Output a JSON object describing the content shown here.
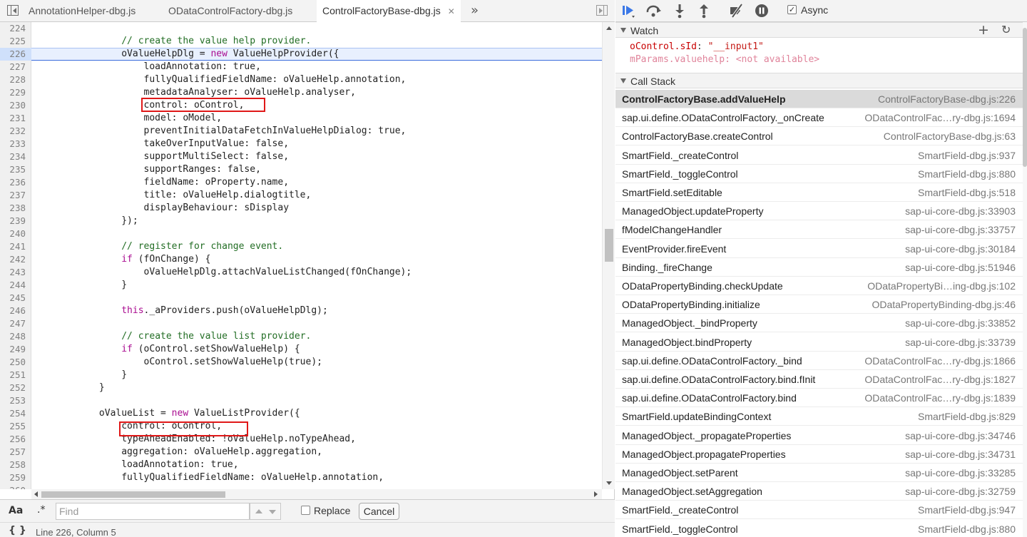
{
  "tabs": [
    {
      "label": "AnnotationHelper-dbg.js",
      "active": false
    },
    {
      "label": "ODataControlFactory-dbg.js",
      "active": false
    },
    {
      "label": "ControlFactoryBase-dbg.js",
      "active": true
    }
  ],
  "editor": {
    "current_line": 226,
    "lines": [
      {
        "n": "224",
        "text": ""
      },
      {
        "n": "225",
        "text": "                // create the value help provider."
      },
      {
        "n": "226",
        "text": "                oValueHelpDlg = new ValueHelpProvider({"
      },
      {
        "n": "227",
        "text": "                    loadAnnotation: true,"
      },
      {
        "n": "228",
        "text": "                    fullyQualifiedFieldName: oValueHelp.annotation,"
      },
      {
        "n": "229",
        "text": "                    metadataAnalyser: oValueHelp.analyser,"
      },
      {
        "n": "230",
        "text": "                    control: oControl,"
      },
      {
        "n": "231",
        "text": "                    model: oModel,"
      },
      {
        "n": "232",
        "text": "                    preventInitialDataFetchInValueHelpDialog: true,"
      },
      {
        "n": "233",
        "text": "                    takeOverInputValue: false,"
      },
      {
        "n": "234",
        "text": "                    supportMultiSelect: false,"
      },
      {
        "n": "235",
        "text": "                    supportRanges: false,"
      },
      {
        "n": "236",
        "text": "                    fieldName: oProperty.name,"
      },
      {
        "n": "237",
        "text": "                    title: oValueHelp.dialogtitle,"
      },
      {
        "n": "238",
        "text": "                    displayBehaviour: sDisplay"
      },
      {
        "n": "239",
        "text": "                });"
      },
      {
        "n": "240",
        "text": ""
      },
      {
        "n": "241",
        "text": "                // register for change event."
      },
      {
        "n": "242",
        "text": "                if (fOnChange) {"
      },
      {
        "n": "243",
        "text": "                    oValueHelpDlg.attachValueListChanged(fOnChange);"
      },
      {
        "n": "244",
        "text": "                }"
      },
      {
        "n": "245",
        "text": ""
      },
      {
        "n": "246",
        "text": "                this._aProviders.push(oValueHelpDlg);"
      },
      {
        "n": "247",
        "text": ""
      },
      {
        "n": "248",
        "text": "                // create the value list provider."
      },
      {
        "n": "249",
        "text": "                if (oControl.setShowValueHelp) {"
      },
      {
        "n": "250",
        "text": "                    oControl.setShowValueHelp(true);"
      },
      {
        "n": "251",
        "text": "                }"
      },
      {
        "n": "252",
        "text": "            }"
      },
      {
        "n": "253",
        "text": ""
      },
      {
        "n": "254",
        "text": "            oValueList = new ValueListProvider({"
      },
      {
        "n": "255",
        "text": "                control: oControl,"
      },
      {
        "n": "256",
        "text": "                typeAheadEnabled: !oValueHelp.noTypeAhead,"
      },
      {
        "n": "257",
        "text": "                aggregation: oValueHelp.aggregation,"
      },
      {
        "n": "258",
        "text": "                loadAnnotation: true,"
      },
      {
        "n": "259",
        "text": "                fullyQualifiedFieldName: oValueHelp.annotation,"
      },
      {
        "n": "260",
        "text": ""
      }
    ]
  },
  "find": {
    "case_label": "Aa",
    "regex_label": ".*",
    "placeholder": "Find",
    "replace_label": "Replace",
    "cancel_label": "Cancel"
  },
  "status": {
    "pretty_print_label": "{ }",
    "position_text": "Line 226, Column 5"
  },
  "debugger": {
    "async_label": "Async",
    "async_checked": true
  },
  "watch": {
    "title": "Watch",
    "items": [
      {
        "name": "oControl.sId",
        "value": "\"__input1\""
      },
      {
        "name": "mParams.valuehelp",
        "value": "<not available>"
      }
    ]
  },
  "callstack": {
    "title": "Call Stack",
    "frames": [
      {
        "fn": "ControlFactoryBase.addValueHelp",
        "loc": "ControlFactoryBase-dbg.js:226",
        "selected": true
      },
      {
        "fn": "sap.ui.define.ODataControlFactory._onCreate",
        "loc": "ODataControlFac…ry-dbg.js:1694"
      },
      {
        "fn": "ControlFactoryBase.createControl",
        "loc": "ControlFactoryBase-dbg.js:63"
      },
      {
        "fn": "SmartField._createControl",
        "loc": "SmartField-dbg.js:937"
      },
      {
        "fn": "SmartField._toggleControl",
        "loc": "SmartField-dbg.js:880"
      },
      {
        "fn": "SmartField.setEditable",
        "loc": "SmartField-dbg.js:518"
      },
      {
        "fn": "ManagedObject.updateProperty",
        "loc": "sap-ui-core-dbg.js:33903"
      },
      {
        "fn": "fModelChangeHandler",
        "loc": "sap-ui-core-dbg.js:33757"
      },
      {
        "fn": "EventProvider.fireEvent",
        "loc": "sap-ui-core-dbg.js:30184"
      },
      {
        "fn": "Binding._fireChange",
        "loc": "sap-ui-core-dbg.js:51946"
      },
      {
        "fn": "ODataPropertyBinding.checkUpdate",
        "loc": "ODataPropertyBi…ing-dbg.js:102"
      },
      {
        "fn": "ODataPropertyBinding.initialize",
        "loc": "ODataPropertyBinding-dbg.js:46"
      },
      {
        "fn": "ManagedObject._bindProperty",
        "loc": "sap-ui-core-dbg.js:33852"
      },
      {
        "fn": "ManagedObject.bindProperty",
        "loc": "sap-ui-core-dbg.js:33739"
      },
      {
        "fn": "sap.ui.define.ODataControlFactory._bind",
        "loc": "ODataControlFac…ry-dbg.js:1866"
      },
      {
        "fn": "sap.ui.define.ODataControlFactory.bind.fInit",
        "loc": "ODataControlFac…ry-dbg.js:1827"
      },
      {
        "fn": "sap.ui.define.ODataControlFactory.bind",
        "loc": "ODataControlFac…ry-dbg.js:1839"
      },
      {
        "fn": "SmartField.updateBindingContext",
        "loc": "SmartField-dbg.js:829"
      },
      {
        "fn": "ManagedObject._propagateProperties",
        "loc": "sap-ui-core-dbg.js:34746"
      },
      {
        "fn": "ManagedObject.propagateProperties",
        "loc": "sap-ui-core-dbg.js:34731"
      },
      {
        "fn": "ManagedObject.setParent",
        "loc": "sap-ui-core-dbg.js:33285"
      },
      {
        "fn": "ManagedObject.setAggregation",
        "loc": "sap-ui-core-dbg.js:32759"
      },
      {
        "fn": "SmartField._createControl",
        "loc": "SmartField-dbg.js:947"
      },
      {
        "fn": "SmartField._toggleControl",
        "loc": "SmartField-dbg.js:880"
      }
    ]
  },
  "colors": {
    "highlight_box": "#e01818",
    "current_line": "#e8f0fe",
    "comment": "#236e25",
    "keyword": "#aa0d91"
  }
}
